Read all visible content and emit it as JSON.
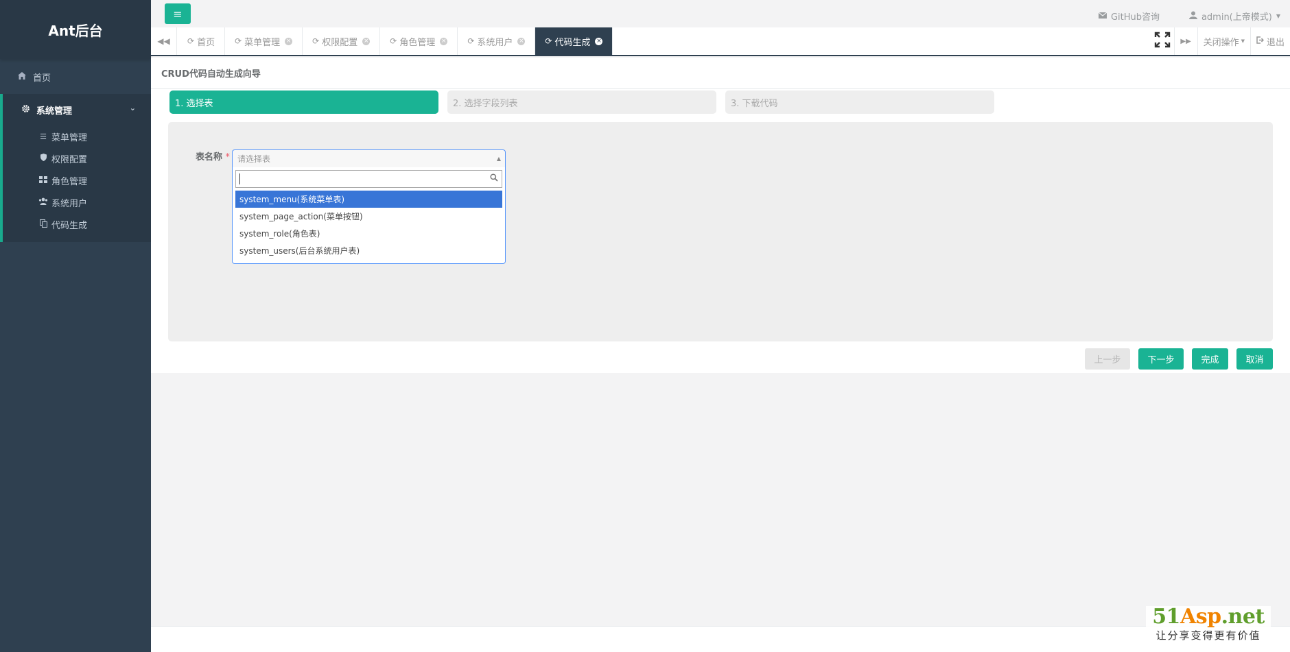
{
  "sidebar": {
    "brand": "Ant后台",
    "home": {
      "label": "首页",
      "icon": "home-icon"
    },
    "group": {
      "label": "系统管理",
      "icon": "gear-icon",
      "items": [
        {
          "label": "菜单管理",
          "icon": "list-icon"
        },
        {
          "label": "权限配置",
          "icon": "shield-icon"
        },
        {
          "label": "角色管理",
          "icon": "grid-icon"
        },
        {
          "label": "系统用户",
          "icon": "users-icon"
        },
        {
          "label": "代码生成",
          "icon": "copy-icon"
        }
      ]
    }
  },
  "topbar": {
    "github": "GitHub咨询",
    "user": "admin(上帝模式)"
  },
  "tabs": [
    {
      "label": "首页",
      "closable": false,
      "active": false
    },
    {
      "label": "菜单管理",
      "closable": true,
      "active": false
    },
    {
      "label": "权限配置",
      "closable": true,
      "active": false
    },
    {
      "label": "角色管理",
      "closable": true,
      "active": false
    },
    {
      "label": "系统用户",
      "closable": true,
      "active": false
    },
    {
      "label": "代码生成",
      "closable": true,
      "active": true
    }
  ],
  "tab_tools": {
    "close_ops": "关闭操作",
    "logout": "退出"
  },
  "content": {
    "title": "CRUD代码自动生成向导",
    "steps": [
      "1. 选择表",
      "2. 选择字段列表",
      "3. 下载代码"
    ],
    "form": {
      "label": "表名称",
      "required_mark": "*",
      "select_placeholder": "请选择表",
      "options": [
        "system_menu(系统菜单表)",
        "system_page_action(菜单按钮)",
        "system_role(角色表)",
        "system_users(后台系统用户表)"
      ]
    },
    "buttons": {
      "prev": "上一步",
      "next": "下一步",
      "finish": "完成",
      "cancel": "取消"
    }
  },
  "watermark": {
    "logo_a": "51",
    "logo_b": "Asp",
    "logo_c": ".net",
    "slogan": "让分享变得更有价值"
  },
  "colors": {
    "sidebar": "#2f4050",
    "accent": "#1ab394",
    "highlight": "#3875d7"
  }
}
